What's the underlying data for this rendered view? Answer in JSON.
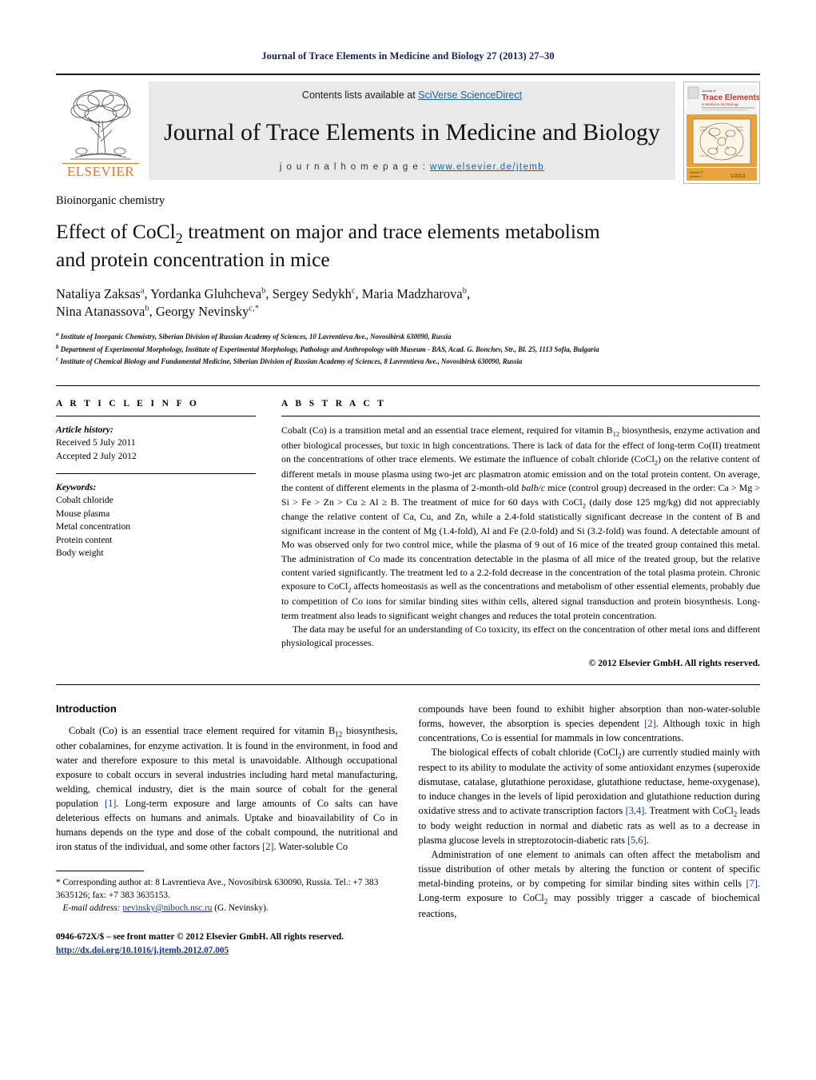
{
  "running_head": "Journal of Trace Elements in Medicine and Biology 27 (2013) 27–30",
  "masthead": {
    "publisher_name": "ELSEVIER",
    "contents_prefix": "Contents lists available at ",
    "contents_link": "SciVerse ScienceDirect",
    "journal_title": "Journal of Trace Elements in Medicine and Biology",
    "homepage_prefix": "j o u r n a l   h o m e p a g e :  ",
    "homepage_url": "www.elsevier.de/jtemb",
    "cover": {
      "kicker": "Journal of",
      "title": "Trace Elements",
      "subtitle": "in Medicine and Biology",
      "volume_label": "27(1)",
      "date_label": "1/2013"
    }
  },
  "article": {
    "category": "Bioinorganic chemistry",
    "title_part1": "Effect of CoCl",
    "title_sub": "2",
    "title_part2": " treatment on major and trace elements metabolism",
    "title_line2": "and protein concentration in mice",
    "authors": [
      {
        "name": "Nataliya Zaksas",
        "marks": "a",
        "sep": ", "
      },
      {
        "name": "Yordanka Gluhcheva",
        "marks": "b",
        "sep": ", "
      },
      {
        "name": "Sergey Sedykh",
        "marks": "c",
        "sep": ", "
      },
      {
        "name": "Maria Madzharova",
        "marks": "b",
        "sep": ","
      },
      {
        "name": "Nina Atanassova",
        "marks": "b",
        "sep": ", "
      },
      {
        "name": "Georgy Nevinsky",
        "marks": "c,*",
        "sep": ""
      }
    ],
    "affiliations": [
      {
        "mark": "a",
        "text": "Institute of Inorganic Chemistry, Siberian Division of Russian Academy of Sciences, 10 Lavrentieva Ave., Novosibirsk 630090, Russia"
      },
      {
        "mark": "b",
        "text": "Department of Experimental Morphology, Institute of Experimental Morphology, Pathology and Anthropology with Museum - BAS, Acad. G. Bonchev, Str., Bl. 25, 1113 Sofia, Bulgaria"
      },
      {
        "mark": "c",
        "text": "Institute of Chemical Biology and Fundamental Medicine, Siberian Division of Russian Academy of Sciences, 8 Lavrentieva Ave., Novosibirsk 630090, Russia"
      }
    ]
  },
  "article_info": {
    "heading": "A R T I C L E   I N F O",
    "history_label": "Article history:",
    "received": "Received 5 July 2011",
    "accepted": "Accepted 2 July 2012",
    "keywords_label": "Keywords:",
    "keywords": [
      "Cobalt chloride",
      "Mouse plasma",
      "Metal concentration",
      "Protein content",
      "Body weight"
    ]
  },
  "abstract": {
    "heading": "A B S T R A C T",
    "paragraph1": "Cobalt (Co) is a transition metal and an essential trace element, required for vitamin B12 biosynthesis, enzyme activation and other biological processes, but toxic in high concentrations. There is lack of data for the effect of long-term Co(II) treatment on the concentrations of other trace elements. We estimate the influence of cobalt chloride (CoCl2) on the relative content of different metals in mouse plasma using two-jet arc plasmatron atomic emission and on the total protein content. On average, the content of different elements in the plasma of 2-month-old balb/c mice (control group) decreased in the order: Ca > Mg > Si > Fe > Zn > Cu ≥ Al ≥ B. The treatment of mice for 60 days with CoCl2 (daily dose 125 mg/kg) did not appreciably change the relative content of Ca, Cu, and Zn, while a 2.4-fold statistically significant decrease in the content of B and significant increase in the content of Mg (1.4-fold), Al and Fe (2.0-fold) and Si (3.2-fold) was found. A detectable amount of Mo was observed only for two control mice, while the plasma of 9 out of 16 mice of the treated group contained this metal. The administration of Co made its concentration detectable in the plasma of all mice of the treated group, but the relative content varied significantly. The treatment led to a 2.2-fold decrease in the concentration of the total plasma protein. Chronic exposure to CoCl2 affects homeostasis as well as the concentrations and metabolism of other essential elements, probably due to competition of Co ions for similar binding sites within cells, altered signal transduction and protein biosynthesis. Long-term treatment also leads to significant weight changes and reduces the total protein concentration.",
    "paragraph2": "The data may be useful for an understanding of Co toxicity, its effect on the concentration of other metal ions and different physiological processes.",
    "copyright": "© 2012 Elsevier GmbH. All rights reserved."
  },
  "introduction": {
    "heading": "Introduction",
    "left_p1": "Cobalt (Co) is an essential trace element required for vitamin B12 biosynthesis, other cobalamines, for enzyme activation. It is found in the environment, in food and water and therefore exposure to this metal is unavoidable. Although occupational exposure to cobalt occurs in several industries including hard metal manufacturing, welding, chemical industry, diet is the main source of cobalt for the general population [1]. Long-term exposure and large amounts of Co salts can have deleterious effects on humans and animals. Uptake and bioavailability of Co in humans depends on the type and dose of the cobalt compound, the nutritional and iron status of the individual, and some other factors [2]. Water-soluble Co",
    "right_p1": "compounds have been found to exhibit higher absorption than non-water-soluble forms, however, the absorption is species dependent [2]. Although toxic in high concentrations, Co is essential for mammals in low concentrations.",
    "right_p2": "The biological effects of cobalt chloride (CoCl2) are currently studied mainly with respect to its ability to modulate the activity of some antioxidant enzymes (superoxide dismutase, catalase, glutathione peroxidase, glutathione reductase, heme-oxygenase), to induce changes in the levels of lipid peroxidation and glutathione reduction during oxidative stress and to activate transcription factors [3,4]. Treatment with CoCl2 leads to body weight reduction in normal and diabetic rats as well as to a decrease in plasma glucose levels in streptozotocin-diabetic rats [5,6].",
    "right_p3": "Administration of one element to animals can often affect the metabolism and tissue distribution of other metals by altering the function or content of specific metal-binding proteins, or by competing for similar binding sites within cells [7]. Long-term exposure to CoCl2 may possibly trigger a cascade of biochemical reactions,"
  },
  "footer": {
    "corresponding_marker": "*",
    "corresponding": "Corresponding author at: 8 Lavrentieva Ave., Novosibirsk 630090, Russia.",
    "tel_fax": "Tel.: +7 383 3635126; fax: +7 383 3635153.",
    "email_label": "E-mail address:",
    "email": "nevinsky@niboch.nsc.ru",
    "email_owner": "(G. Nevinsky).",
    "issn": "0946-672X/$ – see front matter © 2012 Elsevier GmbH. All rights reserved.",
    "doi": "http://dx.doi.org/10.1016/j.jtemb.2012.07.005"
  },
  "colors": {
    "link_blue": "#1f5fa9",
    "ref_blue": "#16348c",
    "elsevier_orange": "#E87722",
    "band_gray": "#e9e9e9"
  }
}
